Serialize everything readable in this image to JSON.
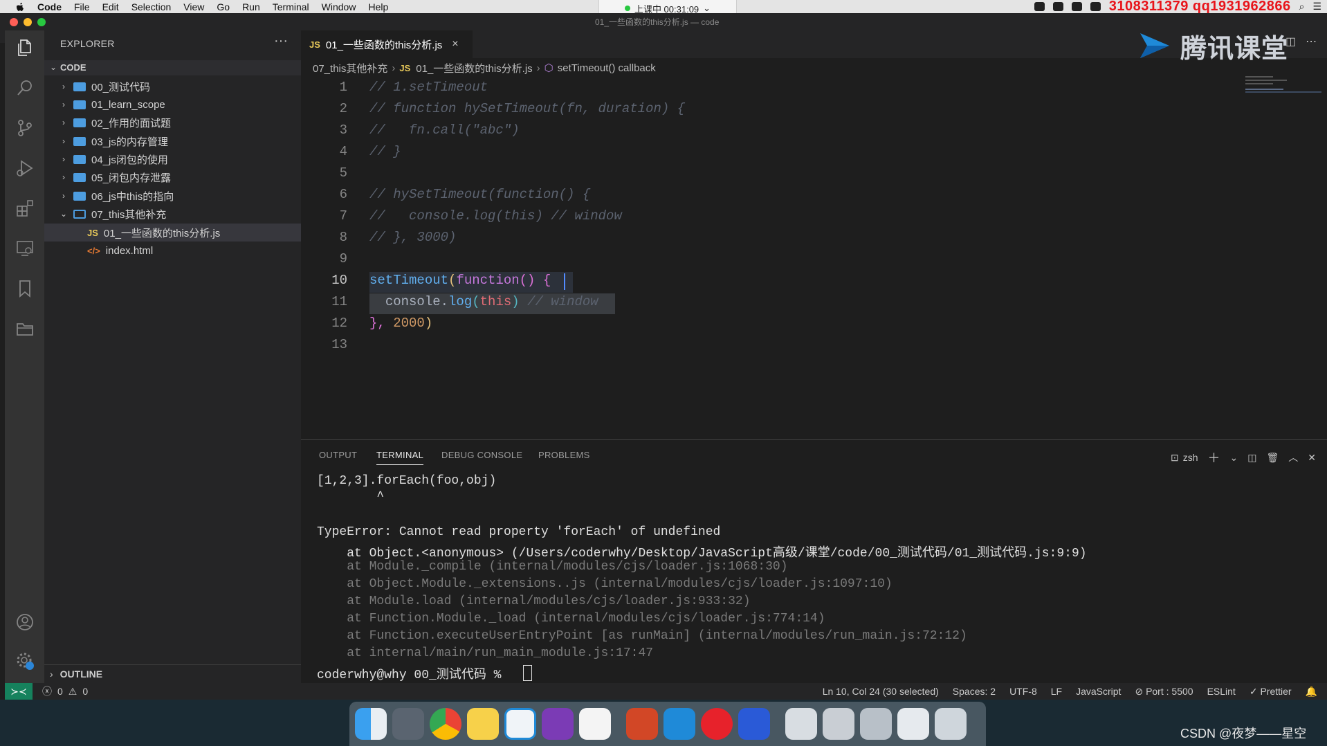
{
  "menubar": {
    "app_name": "Code",
    "items": [
      "File",
      "Edit",
      "Selection",
      "View",
      "Go",
      "Run",
      "Terminal",
      "Window",
      "Help"
    ],
    "meeting_status": "上课中 00:31:09",
    "red_watermark": "3108311379 qq1931962866"
  },
  "window_title": "01_一些函数的this分析.js — code",
  "explorer": {
    "title": "EXPLORER",
    "more": "···",
    "section": "CODE",
    "tree": [
      {
        "label": "00_测试代码",
        "kind": "folder"
      },
      {
        "label": "01_learn_scope",
        "kind": "folder"
      },
      {
        "label": "02_作用的面试题",
        "kind": "folder"
      },
      {
        "label": "03_js的内存管理",
        "kind": "folder"
      },
      {
        "label": "04_js闭包的使用",
        "kind": "folder"
      },
      {
        "label": "05_闭包内存泄露",
        "kind": "folder"
      },
      {
        "label": "06_js中this的指向",
        "kind": "folder"
      },
      {
        "label": "07_this其他补充",
        "kind": "folder-open"
      },
      {
        "label": "01_一些函数的this分析.js",
        "kind": "js",
        "icon": "JS"
      },
      {
        "label": "index.html",
        "kind": "html",
        "icon": "</>"
      }
    ],
    "outline": "OUTLINE"
  },
  "tab": {
    "icon": "JS",
    "label": "01_一些函数的this分析.js",
    "close": "×"
  },
  "breadcrumb": {
    "folder": "07_this其他补充",
    "file_icon": "JS",
    "file": "01_一些函数的this分析.js",
    "symbol": "setTimeout() callback"
  },
  "editor": {
    "line_numbers": [
      "1",
      "2",
      "3",
      "4",
      "5",
      "6",
      "7",
      "8",
      "9",
      "10",
      "11",
      "12",
      "13"
    ],
    "lines": {
      "l1": "// 1.setTimeout",
      "l2": "// function hySetTimeout(fn, duration) {",
      "l3": "//   fn.call(\"abc\")",
      "l4": "// }",
      "l6": "// hySetTimeout(function() {",
      "l7": "//   console.log(this) // window",
      "l8": "// }, 3000)",
      "l10_fn": "setTimeout",
      "l10_p1": "(",
      "l10_kw": "function",
      "l10_p2": "()",
      "l10_b": "{",
      "l11_obj": "console.",
      "l11_fn": "log",
      "l11_p1": "(",
      "l11_this": "this",
      "l11_p2": ")",
      "l11_cmt": "// window",
      "l12_b": "},",
      "l12_num": "2000",
      "l12_p": ")"
    }
  },
  "logo": {
    "text": "腾讯课堂"
  },
  "panel": {
    "tabs": [
      "OUTPUT",
      "TERMINAL",
      "DEBUG CONSOLE",
      "PROBLEMS"
    ],
    "active_tab": "TERMINAL",
    "shell": "zsh",
    "terminal_lines": [
      "[1,2,3].forEach(foo,obj)",
      "        ^",
      "",
      "TypeError: Cannot read property 'forEach' of undefined",
      "    at Object.<anonymous> (/Users/coderwhy/Desktop/JavaScript高级/课堂/code/00_测试代码/01_测试代码.js:9:9)",
      "    at Module._compile (internal/modules/cjs/loader.js:1068:30)",
      "    at Object.Module._extensions..js (internal/modules/cjs/loader.js:1097:10)",
      "    at Module.load (internal/modules/cjs/loader.js:933:32)",
      "    at Function.Module._load (internal/modules/cjs/loader.js:774:14)",
      "    at Function.executeUserEntryPoint [as runMain] (internal/modules/run_main.js:72:12)",
      "    at internal/main/run_main_module.js:17:47"
    ],
    "prompt": "coderwhy@why 00_测试代码 % "
  },
  "statusbar": {
    "errors": "0",
    "warnings": "0",
    "cursor_pos": "Ln 10, Col 24 (30 selected)",
    "spaces": "Spaces: 2",
    "encoding": "UTF-8",
    "eol": "LF",
    "language": "JavaScript",
    "port": "Port : 5500",
    "eslint": "ESLint",
    "prettier": "Prettier"
  },
  "dock": {
    "icons": [
      "finder-icon",
      "launchpad-icon",
      "chrome-icon",
      "notes-icon",
      "vscode-icon",
      "onenote-icon",
      "typora-icon",
      "powerpoint-icon",
      "tencent-class-icon",
      "netease-music-icon",
      "app-icon",
      "preview-icon",
      "keyboard-icon",
      "screen-icon",
      "phone-icon",
      "trash-icon"
    ]
  },
  "csdn_watermark": "CSDN @夜梦——星空"
}
